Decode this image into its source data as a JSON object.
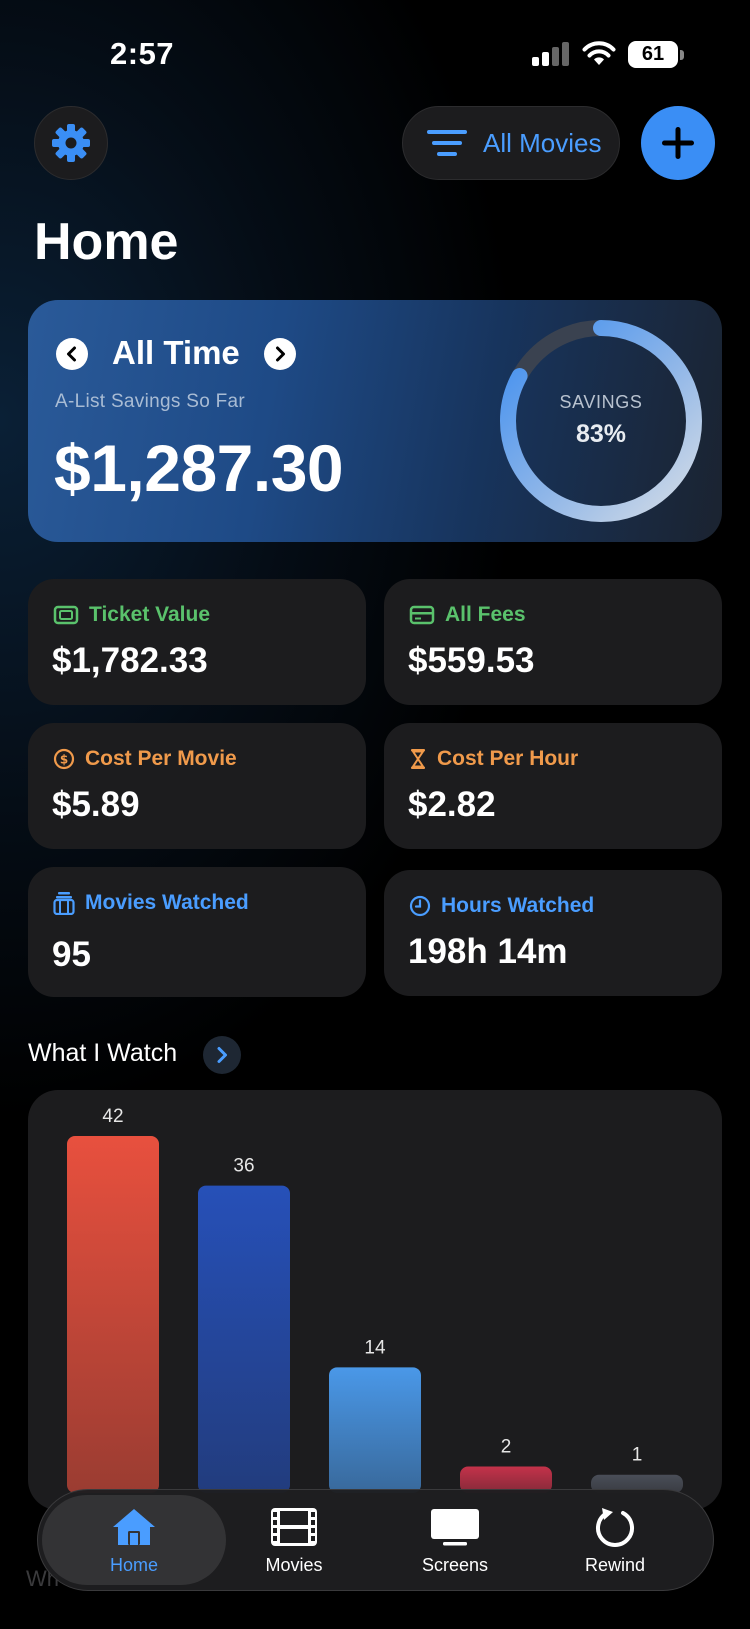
{
  "status_bar": {
    "time": "2:57",
    "battery": "61"
  },
  "header": {
    "settings_icon": "gear-icon",
    "filter_label": "All Movies",
    "filter_icon": "filter-lines-icon",
    "add_icon": "plus-icon",
    "title": "Home"
  },
  "savings": {
    "period": "All Time",
    "subtitle": "A-List Savings So Far",
    "amount": "$1,287.30",
    "ring_label": "SAVINGS",
    "ring_value": "83%",
    "percent": 0.83
  },
  "stats": {
    "ticket_value": {
      "label": "Ticket Value",
      "value": "$1,782.33",
      "icon": "ticket-icon",
      "color": "#5ac26c"
    },
    "all_fees": {
      "label": "All Fees",
      "value": "$559.53",
      "icon": "credit-card-icon",
      "color": "#5ac26c"
    },
    "cost_per_movie": {
      "label": "Cost Per Movie",
      "value": "$5.89",
      "icon": "dollar-coin-icon",
      "color": "#f09a4b"
    },
    "cost_per_hour": {
      "label": "Cost Per Hour",
      "value": "$2.82",
      "icon": "hourglass-icon",
      "color": "#f09a4b"
    },
    "movies_watched": {
      "label": "Movies Watched",
      "value": "95",
      "icon": "film-stack-icon",
      "color": "#4a9dff"
    },
    "hours_watched": {
      "label": "Hours Watched",
      "value": "198h 14m",
      "icon": "clock-icon",
      "color": "#4a9dff"
    }
  },
  "what_i_watch": {
    "title": "What I Watch"
  },
  "chart_data": {
    "type": "bar",
    "categories": [
      "",
      "",
      "",
      "",
      ""
    ],
    "values": [
      42,
      36,
      14,
      2,
      1
    ],
    "colors": [
      "#e8503e",
      "#2650b8",
      "#4a98e8",
      "#c4324a",
      "#4a4e58"
    ],
    "ylim": [
      0,
      42
    ]
  },
  "tabbar": {
    "tabs": [
      {
        "label": "Home",
        "icon": "house-icon",
        "active": true
      },
      {
        "label": "Movies",
        "icon": "film-strip-icon",
        "active": false
      },
      {
        "label": "Screens",
        "icon": "screen-icon",
        "active": false
      },
      {
        "label": "Rewind",
        "icon": "rewind-arrow-icon",
        "active": false
      }
    ]
  },
  "footer_fade_text": "Wh"
}
